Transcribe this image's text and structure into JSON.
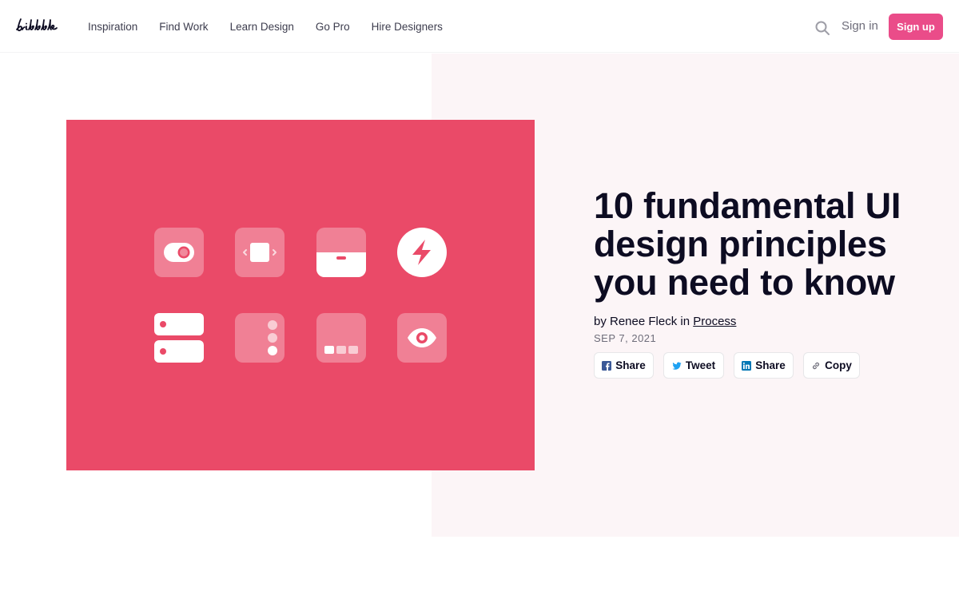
{
  "header": {
    "logo_text": "dribbble",
    "nav": [
      "Inspiration",
      "Find Work",
      "Learn Design",
      "Go Pro",
      "Hire Designers"
    ],
    "sign_in": "Sign in",
    "sign_up": "Sign up",
    "search_icon": "search-icon",
    "brand_color": "#ea4c89"
  },
  "hero": {
    "image_color": "#ea4a68",
    "icons": [
      "toggle-icon",
      "carousel-icon",
      "card-icon",
      "lightning-icon",
      "list-icon",
      "pagination-dots-icon",
      "progress-icon",
      "eye-icon"
    ]
  },
  "article": {
    "title": "10 fundamental UI design principles you need to know",
    "byline_prefix": "by Renee Fleck in",
    "category": "Process",
    "date": "SEP 7, 2021",
    "share_buttons": [
      {
        "icon": "facebook-icon",
        "label": "Share"
      },
      {
        "icon": "twitter-icon",
        "label": "Tweet"
      },
      {
        "icon": "linkedin-icon",
        "label": "Share"
      },
      {
        "icon": "link-icon",
        "label": "Copy"
      }
    ]
  }
}
